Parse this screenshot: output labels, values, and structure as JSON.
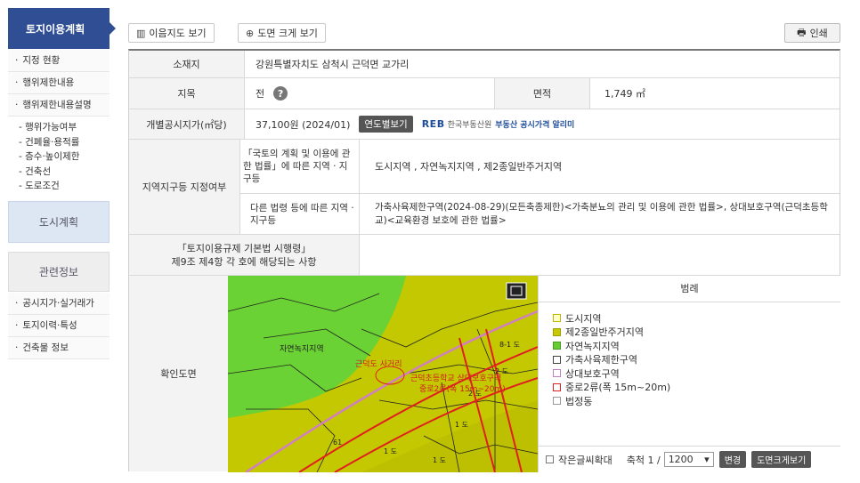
{
  "sidebar": {
    "title": "토지이용계획",
    "items_top": [
      "지정 현황",
      "행위제한내용",
      "행위제한내용설명"
    ],
    "sub_items": [
      "행위가능여부",
      "건폐율·용적률",
      "층수·높이제한",
      "건축선",
      "도로조건"
    ],
    "city_plan": "도시계획",
    "related": "관련정보",
    "items_bottom": [
      "공시지가·실거래가",
      "토지이력·특성",
      "건축물 정보"
    ]
  },
  "toolbar": {
    "map_view": "이음지도 보기",
    "zoom_view": "도면 크게 보기",
    "print": "인쇄"
  },
  "table": {
    "location_label": "소재지",
    "location_value": "강원특별자치도 삼척시 근덕면 교가리",
    "jimok_label": "지목",
    "jimok_value": "전",
    "area_label": "면적",
    "area_value": "1,749 ㎡",
    "price_label": "개별공시지가(㎡당)",
    "price_value": "37,100원 (2024/01)",
    "year_btn": "연도별보기",
    "reb_logo": "REB",
    "reb_text": "한국부동산원",
    "reb_blue": "부동산 공시가격 알리미",
    "zone_label": "지역지구등 지정여부",
    "national_law_label": "「국토의 계획 및 이용에 관한 법률」에 따른 지역 · 지구등",
    "national_law_value": "도시지역 , 자연녹지지역 , 제2종일반주거지역",
    "other_law_label": "다른 법령 등에 따른 지역 · 지구등",
    "other_law_value": "가축사육제한구역(2024-08-29)(모든축종제한)<가축분뇨의 관리 및 이용에 관한 법률>, 상대보호구역(근덕초등학교)<교육환경 보호에 관한 법률>",
    "decree_label_1": "「토지이용규제 기본법 시행령」",
    "decree_label_2": "제9조 제4항 각 호에 해당되는 사항",
    "decree_value": "",
    "confirm_label": "확인도면"
  },
  "map": {
    "label_green": "자연녹지지역",
    "label_parcel": "근덕도 사거리",
    "label_school": "근덕초등학교 상대보호구역",
    "label_road": "중로2류(폭 15m~20m)",
    "parcel_labels": [
      "8-1 도",
      "2 도",
      "1 도",
      "61",
      "1 도",
      "1 도",
      "2 도"
    ]
  },
  "legend": {
    "title": "범례",
    "items": [
      {
        "label": "도시지역",
        "fill": "#ffffcc",
        "border": "#c8b400"
      },
      {
        "label": "제2종일반주거지역",
        "fill": "#c8c800",
        "border": "#a0a000"
      },
      {
        "label": "자연녹지지역",
        "fill": "#66cc33",
        "border": "#4a9a20"
      },
      {
        "label": "가축사육제한구역",
        "fill": "#ffffff",
        "border": "#444444"
      },
      {
        "label": "상대보호구역",
        "fill": "#ffffff",
        "border": "#c080c0"
      },
      {
        "label": "중로2류(폭 15m~20m)",
        "fill": "#ffffff",
        "border": "#e02020"
      },
      {
        "label": "법정동",
        "fill": "#ffffff",
        "border": "#999999"
      }
    ],
    "small_text": "작은글씨확대",
    "scale_label": "축척 1 /",
    "scale_value": "1200",
    "change_btn": "변경",
    "zoom_btn": "도면크게보기"
  }
}
